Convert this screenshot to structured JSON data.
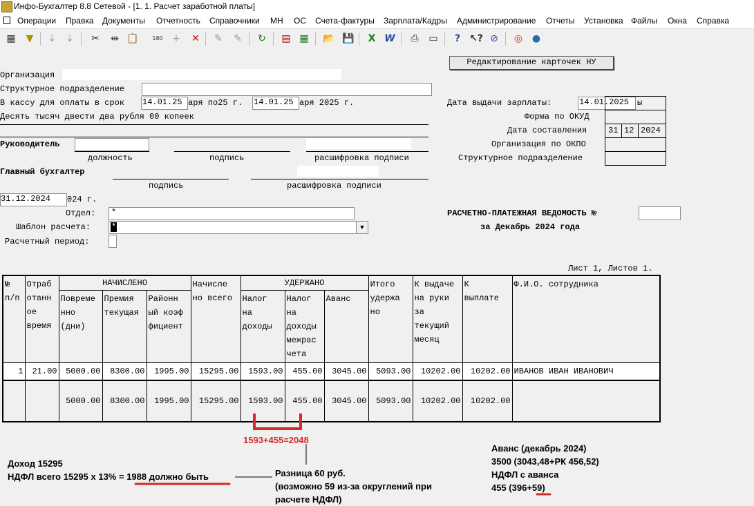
{
  "window": {
    "title": "Инфо-Бухгалтер 8.8 Сетевой - [1. 1. Расчет заработной платы]"
  },
  "menu": [
    "Операции",
    "Правка",
    "Документы",
    "Отчетность",
    "Справочники",
    "МН",
    "ОС",
    "Счета-фактуры",
    "Зарплата/Кадры",
    "Администрирование",
    "Отчеты",
    "Установка",
    "Файлы",
    "Окна",
    "Справка"
  ],
  "toolbar": {
    "icons": [
      "filter-icon",
      "sort-asc-icon",
      "sort-desc-icon",
      "cut-icon",
      "move-icon",
      "paste-icon",
      "count-icon",
      "plus-icon",
      "delete-icon",
      "tool1-icon",
      "tool2-icon",
      "refresh-icon",
      "document-icon",
      "calculator-icon",
      "open-folder-icon",
      "save-icon",
      "excel-icon",
      "word-icon",
      "print-icon",
      "preview-icon",
      "help-icon",
      "context-help-icon",
      "compass-icon",
      "lifebuoy-icon",
      "globe-icon"
    ]
  },
  "form": {
    "edit_cards_button": "Редактирование карточек НУ",
    "org_label": "Организация",
    "struct_label": "Структурное подразделение",
    "cash_label_a": "В кассу для оплаты в срок",
    "cash_date1": "14.01.25",
    "cash_mid": "аря по25 г.",
    "cash_date2": "14.01.25",
    "cash_tail": "аря 2025 г.",
    "amount_words": "Десять тысяч двести два рубля 00 копеек",
    "pay_date_label": "Дата выдачи зарплаты:",
    "pay_date": "14.01.2025",
    "pay_date_tail": "ы",
    "okud_label": "Форма по ОКУД",
    "compile_label": "Дата составления",
    "compile_day": "31",
    "compile_month": "12",
    "compile_year": "2024",
    "okpo_label": "Организация по ОКПО",
    "struct_label2": "Структурное подразделение",
    "head_label": "Руководитель",
    "position_caption": "должность",
    "signature_caption": "подпись",
    "decode_caption": "расшифровка подписи",
    "chief_label": "Главный бухгалтер",
    "signature_caption2": "подпись",
    "decode_caption2": "расшифровка подписи",
    "date_field": "31.12.2024",
    "date_tail": "024 г.",
    "dept_label": "Отдел:",
    "dept_value": "*",
    "template_label": "Шаблон расчета:",
    "template_value": "*",
    "period_label": "Расчетный период:",
    "statement_title": "РАСЧЕТНО-ПЛАТЕЖНАЯ ВЕДОМОСТЬ №",
    "statement_period": "за Декабрь 2024 года",
    "sheet_info": "Лист 1, Листов 1."
  },
  "table": {
    "h_no": [
      "№",
      "п/п"
    ],
    "h_worked": [
      "Отраб",
      "отанн",
      "ое",
      "время"
    ],
    "h_accrued": "НАЧИСЛЕНО",
    "h_time": [
      "Повреме",
      "нно",
      "(дни)"
    ],
    "h_bonus": [
      "Премия",
      "текущая"
    ],
    "h_regional": [
      "Районн",
      "ый коэф",
      "фициент"
    ],
    "h_total": [
      "Начисле",
      "но всего"
    ],
    "h_withheld": "УДЕРЖАНО",
    "h_tax": [
      "Налог",
      "на",
      "доходы"
    ],
    "h_tax_inter": [
      "Налог",
      "на",
      "доходы",
      "межрас",
      "чета"
    ],
    "h_advance": [
      "Аванс"
    ],
    "h_withheld_total": [
      "Итого",
      "удержа",
      "но"
    ],
    "h_payout": [
      "К выдаче",
      "на руки",
      "за",
      "текущий",
      "месяц"
    ],
    "h_topay": [
      "К",
      "выплате"
    ],
    "h_name": [
      "Ф.И.О. сотрудника"
    ],
    "row": {
      "no": "1",
      "worked": "21.00",
      "time": "5000.00",
      "bonus": "8300.00",
      "regional": "1995.00",
      "total": "15295.00",
      "tax": "1593.00",
      "tax_inter": "455.00",
      "advance": "3045.00",
      "withheld_total": "5093.00",
      "payout": "10202.00",
      "topay": "10202.00",
      "name": "ИВАНОВ ИВАН ИВАНОВИЧ"
    },
    "totals": {
      "time": "5000.00",
      "bonus": "8300.00",
      "regional": "1995.00",
      "total": "15295.00",
      "tax": "1593.00",
      "tax_inter": "455.00",
      "advance": "3045.00",
      "withheld_total": "5093.00",
      "payout": "10202.00",
      "topay": "10202.00"
    }
  },
  "annotations": {
    "sum_formula": "1593+455=2048",
    "income": "Доход 15295",
    "ndfl_prefix": "НДФЛ всего 15295 х 13% = ",
    "ndfl_should": "1988 должно быть",
    "diff1": "Разница 60 руб.",
    "diff2": "(возможно 59 из-за округлений при",
    "diff3": "расчете НДФЛ)",
    "adv1": "Аванс (декабрь 2024)",
    "adv2": "3500 (3043,48+РК 456,52)",
    "adv3": "НДФЛ с аванса",
    "adv4_prefix": "455 (396",
    "adv4_red": "+59",
    "adv4_suffix": ")",
    "accent": "#d62828"
  }
}
